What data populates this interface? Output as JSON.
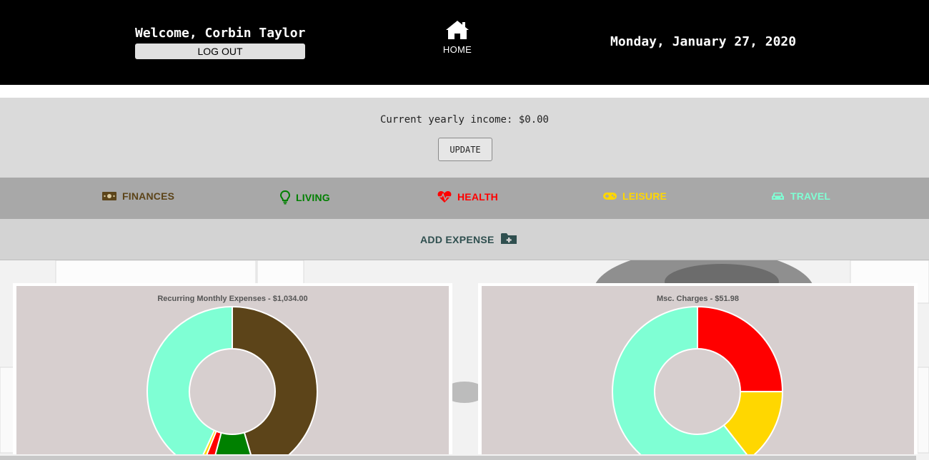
{
  "header": {
    "welcome": "Welcome, Corbin Taylor",
    "logout_label": "LOG OUT",
    "home_label": "HOME",
    "home_icon": "home-icon",
    "date": "Monday, January 27, 2020"
  },
  "income": {
    "text": "Current yearly income: $0.00",
    "update_label": "UPDATE"
  },
  "categories": [
    {
      "label": "FINANCES",
      "icon": "money-bill-icon",
      "color": "#5c4419"
    },
    {
      "label": "LIVING",
      "icon": "lightbulb-icon",
      "color": "#008000"
    },
    {
      "label": "HEALTH",
      "icon": "heartbeat-icon",
      "color": "#ff0000"
    },
    {
      "label": "LEISURE",
      "icon": "gamepad-icon",
      "color": "#ffd700"
    },
    {
      "label": "TRAVEL",
      "icon": "car-icon",
      "color": "#7fffd4"
    }
  ],
  "add_expense": {
    "label": "ADD EXPENSE",
    "icon": "folder-plus-icon"
  },
  "chart_data": [
    {
      "type": "pie",
      "title": "Recurring Monthly Expenses - $1,034.00",
      "categories": [
        "FINANCES",
        "LIVING",
        "HEALTH",
        "LEISURE",
        "TRAVEL"
      ],
      "values": [
        470,
        90,
        20,
        8,
        446
      ],
      "colors": [
        "#5c4419",
        "#008000",
        "#ff0000",
        "#ffd700",
        "#7fffd4"
      ]
    },
    {
      "type": "pie",
      "title": "Msc. Charges - $51.98",
      "categories": [
        "HEALTH",
        "LEISURE",
        "TRAVEL"
      ],
      "values": [
        13,
        7.5,
        31.48
      ],
      "colors": [
        "#ff0000",
        "#ffd700",
        "#7fffd4"
      ]
    }
  ]
}
